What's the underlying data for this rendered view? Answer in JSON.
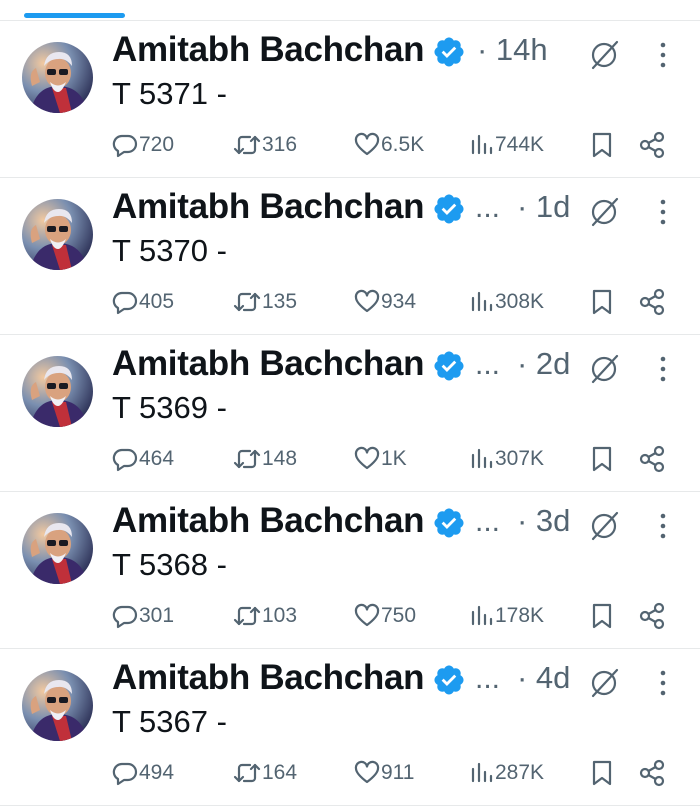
{
  "colors": {
    "accent": "#1d9bf0",
    "text": "#0f1419",
    "muted": "#536471",
    "divider": "#e7e9ea"
  },
  "icons": [
    "verified-badge-icon",
    "grok-icon",
    "more-icon",
    "reply-icon",
    "retweet-icon",
    "like-icon",
    "views-icon",
    "bookmark-icon",
    "share-icon"
  ],
  "tweets": [
    {
      "author": "Amitabh Bachchan",
      "time": "· 14h",
      "truncated": false,
      "text": "T 5371 -",
      "stats": {
        "replies": "720",
        "reposts": "316",
        "likes": "6.5K",
        "views": "744K"
      }
    },
    {
      "author": "Amitabh Bachchan",
      "time": "· 1d",
      "truncated": true,
      "text": "T 5370 -",
      "stats": {
        "replies": "405",
        "reposts": "135",
        "likes": "934",
        "views": "308K"
      }
    },
    {
      "author": "Amitabh Bachchan",
      "time": "· 2d",
      "truncated": true,
      "text": "T 5369 -",
      "stats": {
        "replies": "464",
        "reposts": "148",
        "likes": "1K",
        "views": "307K"
      }
    },
    {
      "author": "Amitabh Bachchan",
      "time": "· 3d",
      "truncated": true,
      "text": "T 5368 -",
      "stats": {
        "replies": "301",
        "reposts": "103",
        "likes": "750",
        "views": "178K"
      }
    },
    {
      "author": "Amitabh Bachchan",
      "time": "· 4d",
      "truncated": true,
      "text": "T 5367 -",
      "stats": {
        "replies": "494",
        "reposts": "164",
        "likes": "911",
        "views": "287K"
      }
    }
  ],
  "ellipsis": "..."
}
